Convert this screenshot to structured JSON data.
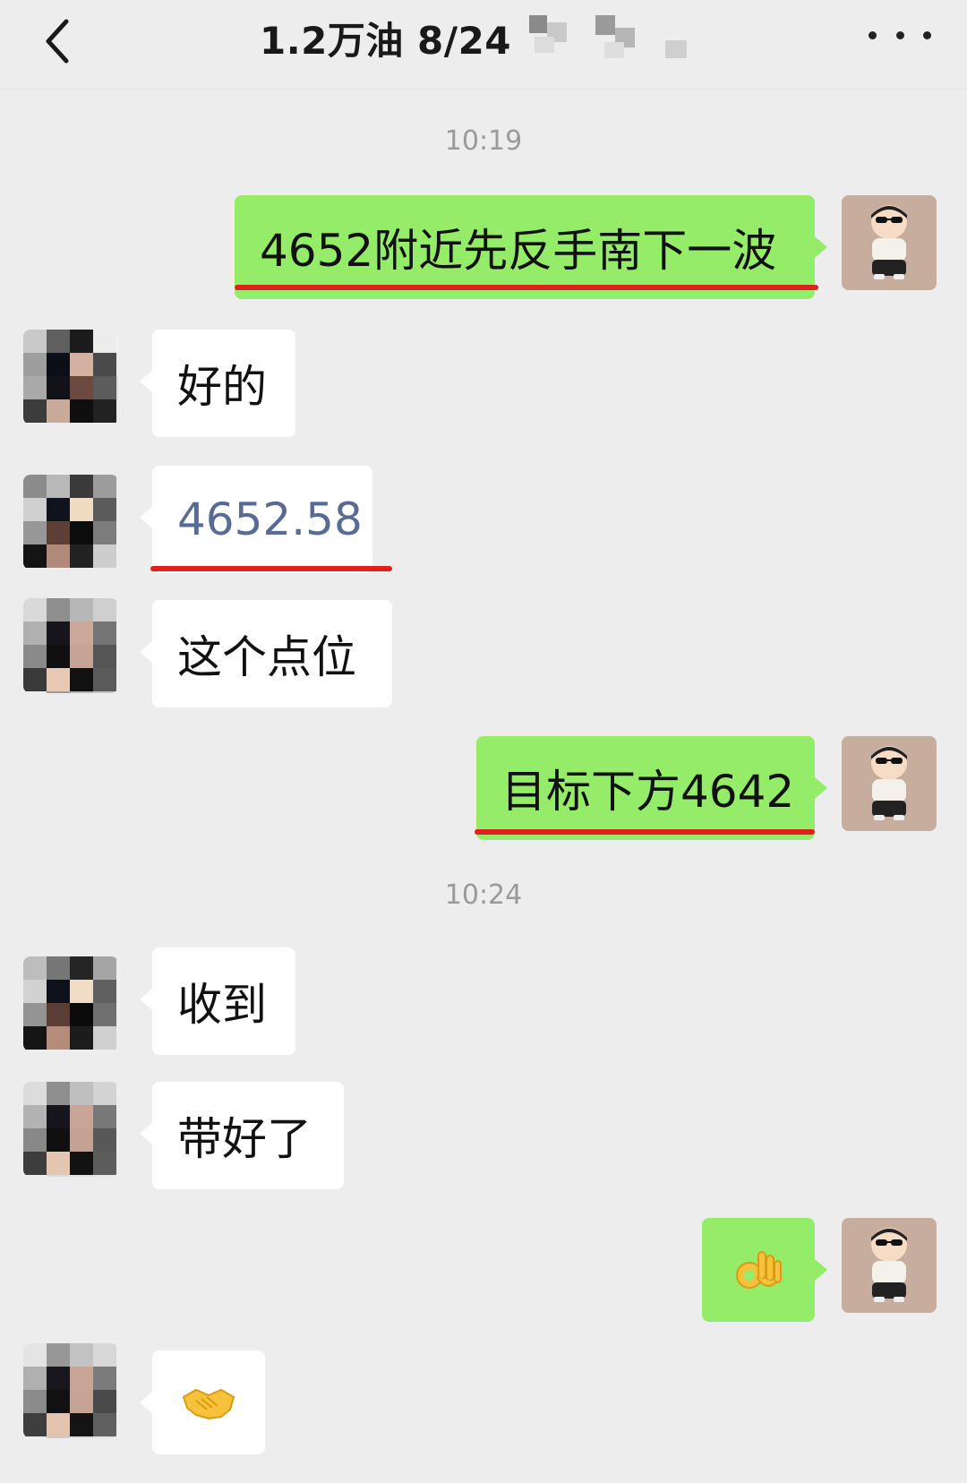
{
  "header": {
    "back_label": "<",
    "title": "1.2万油  8/24",
    "more_label": "…"
  },
  "timestamps": [
    "10:19",
    "10:24"
  ],
  "messages": [
    {
      "side": "out",
      "text": "4652附近先反手南下一波"
    },
    {
      "side": "in",
      "text": "好的"
    },
    {
      "side": "in",
      "text": "4652.58"
    },
    {
      "side": "in",
      "text": "这个点位"
    },
    {
      "side": "out",
      "text": "目标下方4642"
    },
    {
      "side": "in",
      "text": "收到"
    },
    {
      "side": "in",
      "text": "带好了"
    },
    {
      "side": "out",
      "emoji": "ok-hand-icon"
    },
    {
      "side": "in",
      "emoji": "handshake-icon"
    }
  ],
  "colors": {
    "background": "#ededed",
    "outgoing_bubble": "#95ec69",
    "incoming_bubble": "#ffffff",
    "link_text": "#576b95",
    "annotation_underline": "#e02020"
  }
}
